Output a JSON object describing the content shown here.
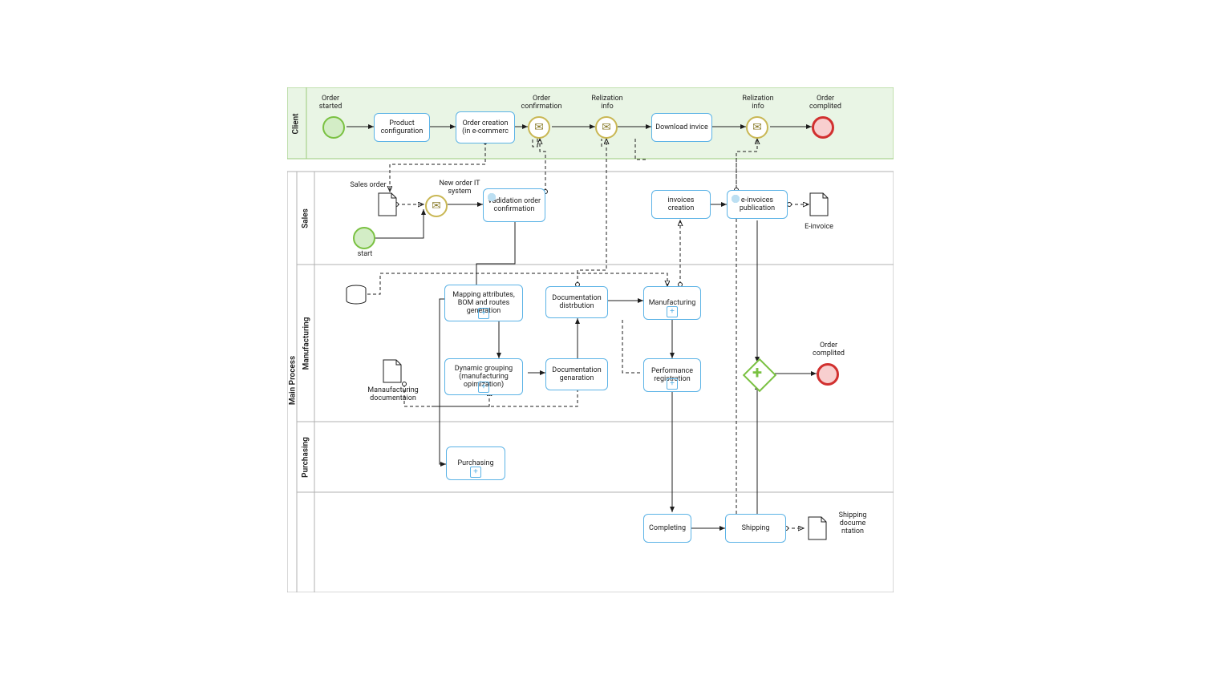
{
  "pools": {
    "client": "Client",
    "main": "Main Process",
    "sales": "Sales",
    "manufacturing": "Manufacturing",
    "purchasing": "Purchasing"
  },
  "clientLane": {
    "orderStarted": "Order started",
    "productConfig": "Product configuration",
    "orderCreation": "Order creation (in e-commerc",
    "orderConfirm": "Order confirmation",
    "relizationInfo1": "Relization info",
    "downloadInvoice": "Download invice",
    "relizationInfo2": "Relization info",
    "orderCompleted": "Order complited"
  },
  "salesLane": {
    "salesOrder": "Sales order",
    "newOrderIT": "New order IT system",
    "validation": "Vadidation order confirmation",
    "start": "start",
    "invoicesCreation": "invoices creation",
    "einvoicesPub": "e-invoices publication",
    "einvoice": "E-invoice"
  },
  "mfgLane": {
    "mapping": "Mapping attributes, BOM and routes generation",
    "docDist": "Documentation distrbution",
    "manufacturing": "Manufacturing",
    "dynamic": "Dynamic grouping (manufacturing opimization)",
    "docGen": "Documentation genaration",
    "perfReg": "Performance registration",
    "mfgDoc": "Manaufacturing documentaion",
    "orderCompleted": "Order complited"
  },
  "purchLane": {
    "purchasing": "Purchasing"
  },
  "shipLane": {
    "completing": "Completing",
    "shipping": "Shipping",
    "shipDoc": "Shipping docume ntation"
  }
}
